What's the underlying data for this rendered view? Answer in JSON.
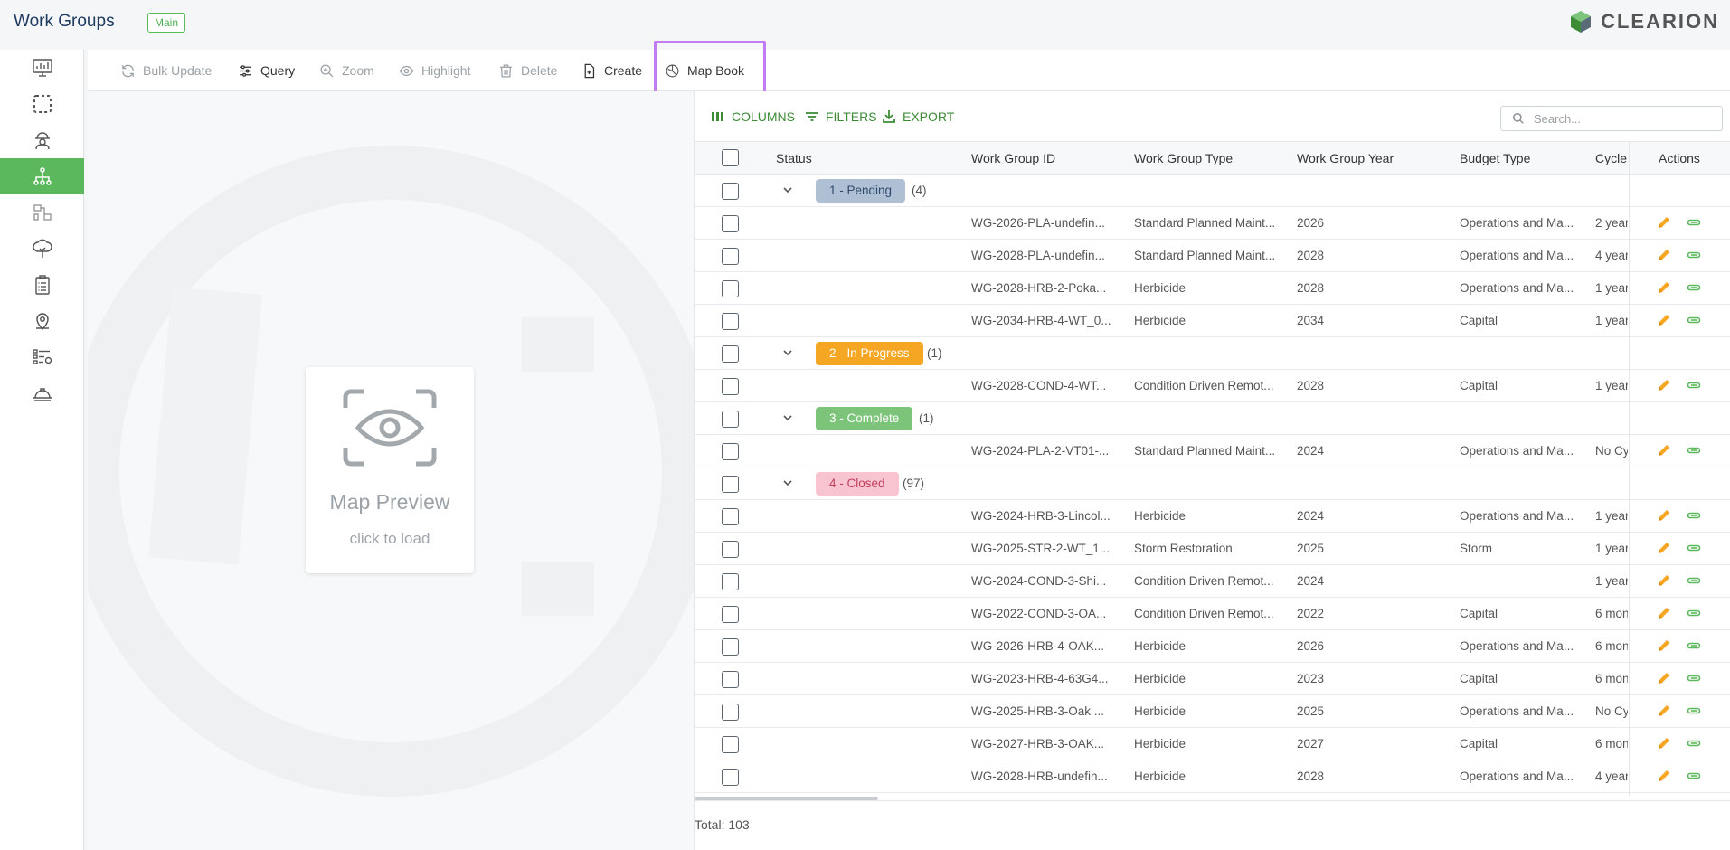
{
  "app": {
    "title": "Work Groups",
    "badge": "Main",
    "brand": "CLEARION"
  },
  "sidebar": {
    "items": [
      {
        "icon": "dashboard-icon",
        "active": false
      },
      {
        "icon": "selection-icon",
        "active": false
      },
      {
        "icon": "worker-icon",
        "active": false
      },
      {
        "icon": "hierarchy-icon",
        "active": true
      },
      {
        "icon": "flow-icon",
        "active": false
      },
      {
        "icon": "tree-icon",
        "active": false
      },
      {
        "icon": "checklist-icon",
        "active": false
      },
      {
        "icon": "location-pin-icon",
        "active": false
      },
      {
        "icon": "list-settings-icon",
        "active": false
      },
      {
        "icon": "hardhat-icon",
        "active": false
      }
    ]
  },
  "toolbar": {
    "bulk_update": "Bulk Update",
    "query": "Query",
    "zoom": "Zoom",
    "highlight": "Highlight",
    "delete": "Delete",
    "create": "Create",
    "map_book": "Map Book"
  },
  "map": {
    "title": "Map Preview",
    "subtitle": "click to load"
  },
  "grid": {
    "toolbar": {
      "columns": "COLUMNS",
      "filters": "FILTERS",
      "export": "EXPORT",
      "search_placeholder": "Search..."
    },
    "headers": {
      "status": "Status",
      "id": "Work Group ID",
      "type": "Work Group Type",
      "year": "Work Group Year",
      "budget": "Budget Type",
      "cycle": "Cycle",
      "actions": "Actions"
    },
    "rows": [
      {
        "kind": "group",
        "label": "1 - Pending",
        "count": "(4)",
        "bg": "#b0c0d4",
        "fg": "#2f4a6d"
      },
      {
        "kind": "data",
        "id": "WG-2026-PLA-undefin...",
        "type": "Standard Planned Maint...",
        "year": "2026",
        "budget": "Operations and Ma...",
        "cycle": "2 year"
      },
      {
        "kind": "data",
        "id": "WG-2028-PLA-undefin...",
        "type": "Standard Planned Maint...",
        "year": "2028",
        "budget": "Operations and Ma...",
        "cycle": "4 year"
      },
      {
        "kind": "data",
        "id": "WG-2028-HRB-2-Poka...",
        "type": "Herbicide",
        "year": "2028",
        "budget": "Operations and Ma...",
        "cycle": "1 year"
      },
      {
        "kind": "data",
        "id": "WG-2034-HRB-4-WT_0...",
        "type": "Herbicide",
        "year": "2034",
        "budget": "Capital",
        "cycle": "1 year"
      },
      {
        "kind": "group",
        "label": "2 - In Progress",
        "count": "(1)",
        "bg": "#f5a623",
        "fg": "#ffffff"
      },
      {
        "kind": "data",
        "id": "WG-2028-COND-4-WT...",
        "type": "Condition Driven Remot...",
        "year": "2028",
        "budget": "Capital",
        "cycle": "1 year"
      },
      {
        "kind": "group",
        "label": "3 - Complete",
        "count": "(1)",
        "bg": "#7cc47a",
        "fg": "#ffffff"
      },
      {
        "kind": "data",
        "id": "WG-2024-PLA-2-VT01-...",
        "type": "Standard Planned Maint...",
        "year": "2024",
        "budget": "Operations and Ma...",
        "cycle": "No Cy"
      },
      {
        "kind": "group",
        "label": "4 - Closed",
        "count": "(97)",
        "bg": "#f8c4cf",
        "fg": "#c2405c"
      },
      {
        "kind": "data",
        "id": "WG-2024-HRB-3-Lincol...",
        "type": "Herbicide",
        "year": "2024",
        "budget": "Operations and Ma...",
        "cycle": "1 year"
      },
      {
        "kind": "data",
        "id": "WG-2025-STR-2-WT_1...",
        "type": "Storm Restoration",
        "year": "2025",
        "budget": "Storm",
        "cycle": "1 year"
      },
      {
        "kind": "data",
        "id": "WG-2024-COND-3-Shi...",
        "type": "Condition Driven Remot...",
        "year": "2024",
        "budget": "",
        "cycle": "1 year"
      },
      {
        "kind": "data",
        "id": "WG-2022-COND-3-OA...",
        "type": "Condition Driven Remot...",
        "year": "2022",
        "budget": "Capital",
        "cycle": "6 mon"
      },
      {
        "kind": "data",
        "id": "WG-2026-HRB-4-OAK...",
        "type": "Herbicide",
        "year": "2026",
        "budget": "Operations and Ma...",
        "cycle": "6 mon"
      },
      {
        "kind": "data",
        "id": "WG-2023-HRB-4-63G4...",
        "type": "Herbicide",
        "year": "2023",
        "budget": "Capital",
        "cycle": "6 mon"
      },
      {
        "kind": "data",
        "id": "WG-2025-HRB-3-Oak ...",
        "type": "Herbicide",
        "year": "2025",
        "budget": "Operations and Ma...",
        "cycle": "No Cy"
      },
      {
        "kind": "data",
        "id": "WG-2027-HRB-3-OAK...",
        "type": "Herbicide",
        "year": "2027",
        "budget": "Capital",
        "cycle": "6 mon"
      },
      {
        "kind": "data",
        "id": "WG-2028-HRB-undefin...",
        "type": "Herbicide",
        "year": "2028",
        "budget": "Operations and Ma...",
        "cycle": "4 year"
      }
    ],
    "total": "Total: 103"
  },
  "colors": {
    "accent": "#5cb85c",
    "link": "#3d8b37",
    "edit": "#f5a623",
    "highlight": "#c07cf0"
  }
}
